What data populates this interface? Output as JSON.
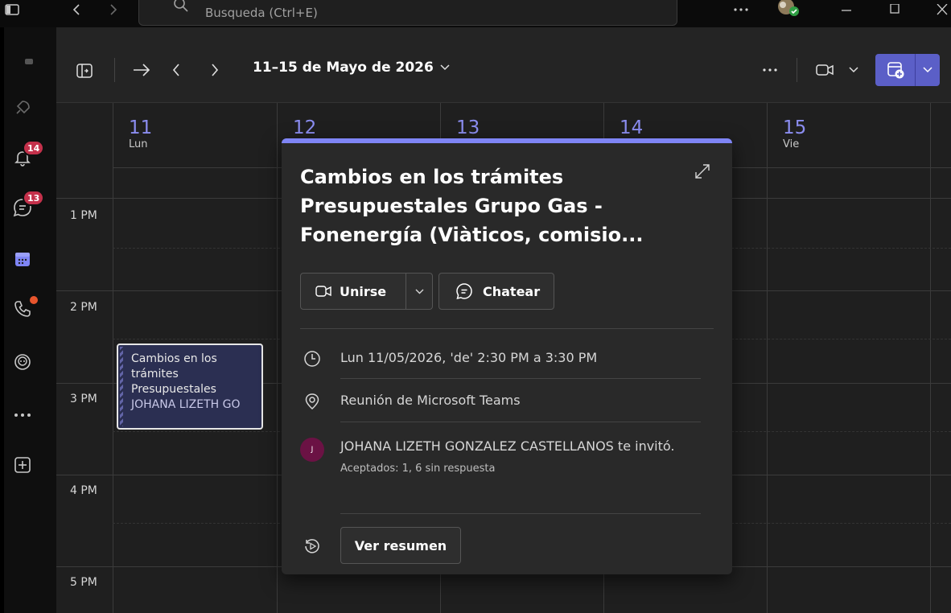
{
  "search": {
    "placeholder": "Busqueda (Ctrl+E)"
  },
  "rail": {
    "activity_badge": "14",
    "chat_badge": "13"
  },
  "header": {
    "date_range": "11–15 de Mayo de 2026"
  },
  "days": [
    {
      "num": "11",
      "name": "Lun"
    },
    {
      "num": "12",
      "name": ""
    },
    {
      "num": "13",
      "name": ""
    },
    {
      "num": "14",
      "name": ""
    },
    {
      "num": "15",
      "name": "Vie"
    }
  ],
  "times": [
    "1 PM",
    "2 PM",
    "3 PM",
    "4 PM",
    "5 PM"
  ],
  "event": {
    "title_line1": "Cambios en los",
    "title_line2": "trámites",
    "title_line3": "Presupuestales",
    "organizer": "JOHANA LIZETH GO"
  },
  "popover": {
    "title": "Cambios en los trámites Presupuestales Grupo Gas - Fonenergía (Viàticos, comisio...",
    "join_label": "Unirse",
    "chat_label": "Chatear",
    "datetime": "Lun 11/05/2026, 'de' 2:30 PM a 3:30 PM",
    "location": "Reunión de Microsoft Teams",
    "avatar_initial": "J",
    "invite_text": "JOHANA LIZETH GONZALEZ CASTELLANOS te invitó.",
    "responses": "Aceptados: 1, 6 sin respuesta",
    "summary_label": "Ver resumen"
  },
  "colors": {
    "accent": "#7f85f5",
    "brand": "#5b5fc7",
    "badge": "#c4314b",
    "event_bg": "#2b2f52"
  }
}
